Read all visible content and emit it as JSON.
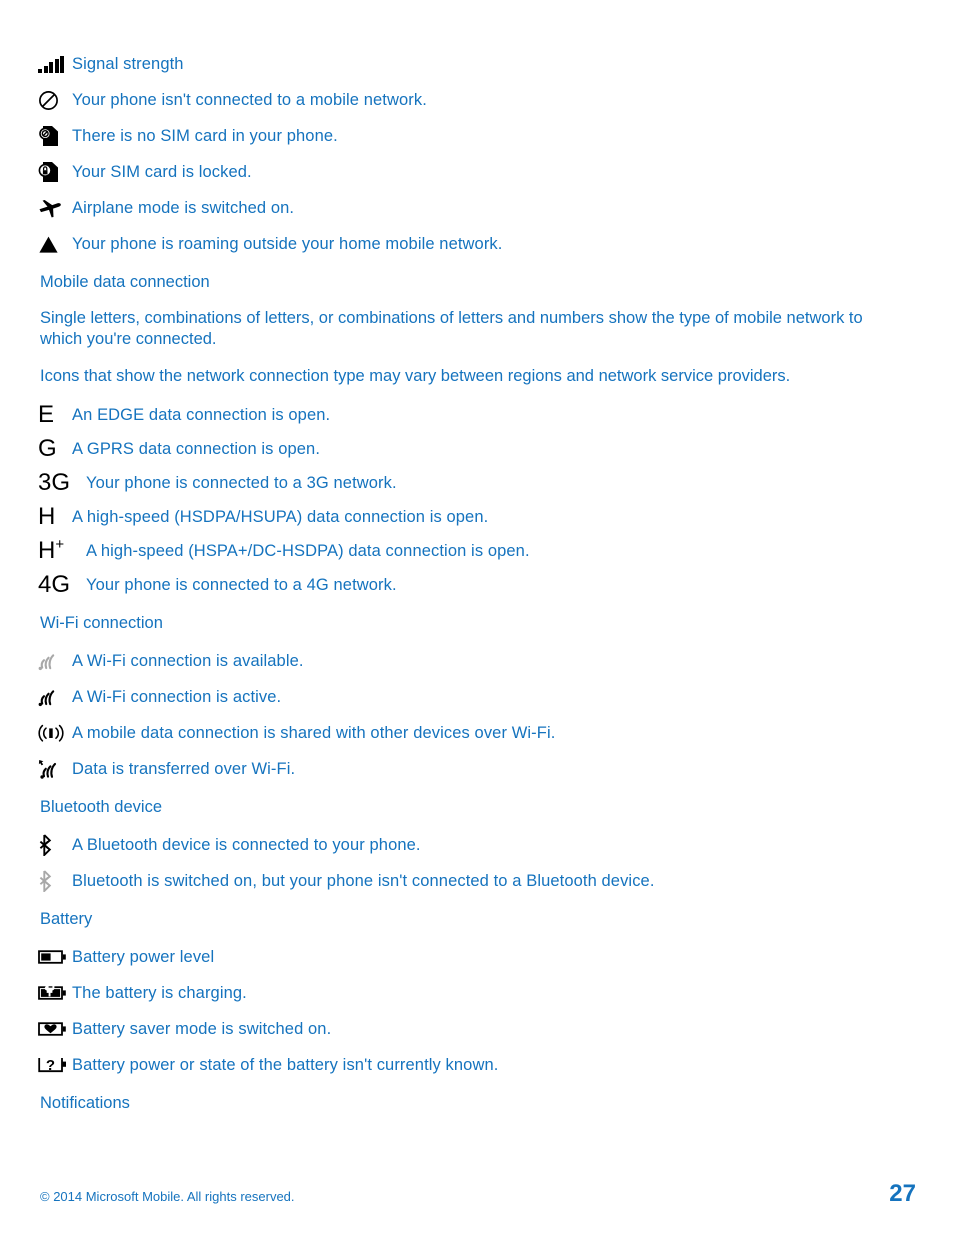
{
  "colors": {
    "text_blue": "#1573be",
    "icon_black": "#000000",
    "icon_gray": "#a8a8a8",
    "background": "#ffffff"
  },
  "status_icons": {
    "rows": [
      {
        "icon": "signal-strength-icon",
        "text": "Signal strength"
      },
      {
        "icon": "no-network-icon",
        "text": "Your phone isn't connected to a mobile network."
      },
      {
        "icon": "no-sim-card-icon",
        "text": "There is no SIM card in your phone."
      },
      {
        "icon": "sim-locked-icon",
        "text": "Your SIM card is locked."
      },
      {
        "icon": "airplane-mode-icon",
        "text": "Airplane mode is switched on."
      },
      {
        "icon": "roaming-icon",
        "text": "Your phone is roaming outside your home mobile network."
      }
    ]
  },
  "mobile_data": {
    "heading": "Mobile data connection",
    "paragraphs": [
      "Single letters, combinations of letters, or combinations of letters and numbers show the type of mobile network to which you're connected.",
      "Icons that show the network connection type may vary between regions and network service providers."
    ],
    "rows": [
      {
        "label": "E",
        "sup": "",
        "text": "An EDGE data connection is open."
      },
      {
        "label": "G",
        "sup": "",
        "text": "A GPRS data connection is open."
      },
      {
        "label": "3G",
        "sup": "",
        "text": "Your phone is connected to a 3G network."
      },
      {
        "label": "H",
        "sup": "",
        "text": "A high-speed (HSDPA/HSUPA) data connection is open."
      },
      {
        "label": "H",
        "sup": "+",
        "text": "A high-speed (HSPA+/DC-HSDPA) data connection is open."
      },
      {
        "label": "4G",
        "sup": "",
        "text": "Your phone is connected to a 4G network."
      }
    ]
  },
  "wifi": {
    "heading": "Wi-Fi connection",
    "rows": [
      {
        "icon": "wifi-available-icon",
        "text": "A Wi-Fi connection is available."
      },
      {
        "icon": "wifi-active-icon",
        "text": "A Wi-Fi connection is active."
      },
      {
        "icon": "mobile-hotspot-icon",
        "text": "A mobile data connection is shared with other devices over Wi-Fi."
      },
      {
        "icon": "wifi-data-transfer-icon",
        "text": "Data is transferred over Wi-Fi."
      }
    ]
  },
  "bluetooth": {
    "heading": "Bluetooth device",
    "rows": [
      {
        "icon": "bluetooth-connected-icon",
        "text": "A Bluetooth device is connected to your phone."
      },
      {
        "icon": "bluetooth-on-icon",
        "text": "Bluetooth is switched on, but your phone isn't connected to a Bluetooth device."
      }
    ]
  },
  "battery": {
    "heading": "Battery",
    "rows": [
      {
        "icon": "battery-level-icon",
        "text": "Battery power level"
      },
      {
        "icon": "battery-charging-icon",
        "text": "The battery is charging."
      },
      {
        "icon": "battery-saver-icon",
        "text": "Battery saver mode is switched on."
      },
      {
        "icon": "battery-unknown-icon",
        "text": "Battery power or state of the battery isn't currently known."
      }
    ]
  },
  "notifications": {
    "heading": "Notifications"
  },
  "footer": {
    "copyright": "© 2014 Microsoft Mobile. All rights reserved.",
    "page_number": "27"
  }
}
